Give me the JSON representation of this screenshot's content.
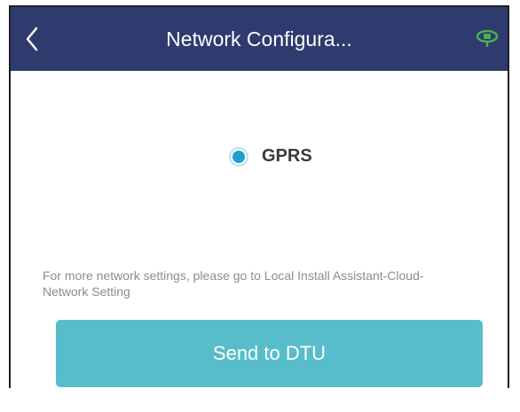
{
  "header": {
    "title": "Network Configura...",
    "back_icon": "chevron-left-icon",
    "status_icon": "connection-status-icon",
    "background_color": "#2f3a6f",
    "status_icon_color": "#4caf50"
  },
  "network_option": {
    "label": "GPRS",
    "selected": true,
    "accent_color": "#1ea0d4"
  },
  "hint_text": "For more network settings, please go to Local Install Assistant-Cloud-Network Setting",
  "send_button": {
    "label": "Send to DTU",
    "color": "#58bdcb"
  }
}
